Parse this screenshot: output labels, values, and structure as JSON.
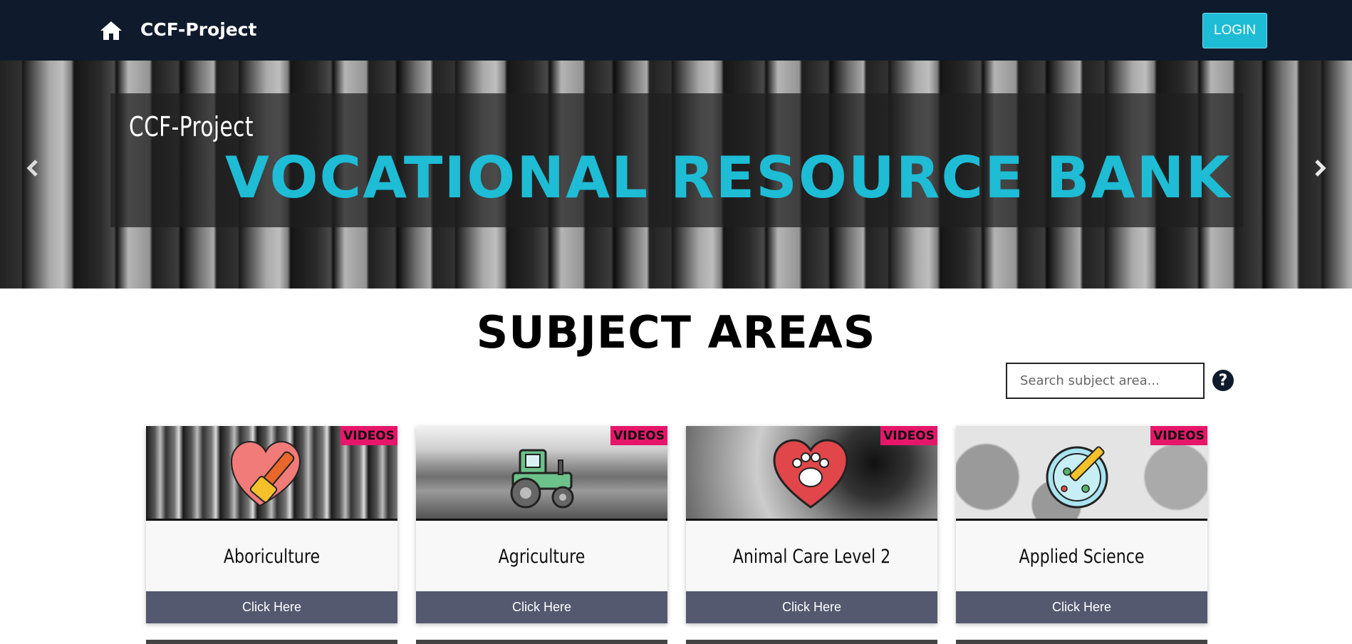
{
  "navbar": {
    "brand": "CCF-Project",
    "login_label": "LOGIN"
  },
  "hero": {
    "kicker": "CCF-Project",
    "title": "VOCATIONAL RESOURCE BANK"
  },
  "section": {
    "title": "SUBJECT AREAS"
  },
  "search": {
    "placeholder": "Search subject area..."
  },
  "cards": [
    {
      "name": "Aboriculture",
      "badge": "VIDEOS",
      "button": "Click Here",
      "icon": "heart-chainsaw-icon"
    },
    {
      "name": "Agriculture",
      "badge": "VIDEOS",
      "button": "Click Here",
      "icon": "tractor-icon"
    },
    {
      "name": "Animal Care Level 2",
      "badge": "VIDEOS",
      "button": "Click Here",
      "icon": "heart-paw-icon"
    },
    {
      "name": "Applied Science",
      "badge": "VIDEOS",
      "button": "Click Here",
      "icon": "petri-dish-syringe-icon"
    }
  ],
  "colors": {
    "nav_bg": "#0f1b2c",
    "accent": "#1ebcd5",
    "badge": "#e6176a",
    "card_button": "#545970"
  }
}
